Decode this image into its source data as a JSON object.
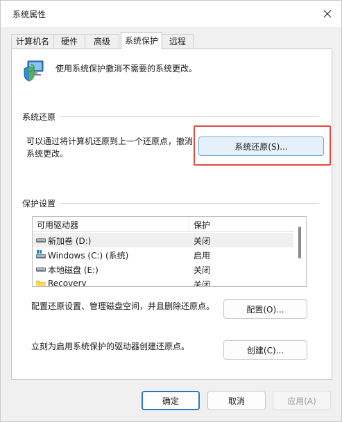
{
  "window": {
    "title": "系统属性"
  },
  "tabs": [
    {
      "label": "计算机名",
      "active": false
    },
    {
      "label": "硬件",
      "active": false
    },
    {
      "label": "高级",
      "active": false
    },
    {
      "label": "系统保护",
      "active": true
    },
    {
      "label": "远程",
      "active": false
    }
  ],
  "intro": {
    "text": "使用系统保护撤消不需要的系统更改。",
    "icon": "computer-shield-icon"
  },
  "restore": {
    "heading": "系统还原",
    "desc_line1": "可以通过将计算机还原到上一个还原点，撤消",
    "desc_line2": "系统更改。",
    "button": "系统还原(S)..."
  },
  "protection": {
    "heading": "保护设置",
    "col_drive": "可用驱动器",
    "col_protection": "保护",
    "drives": [
      {
        "name": "新加卷 (D:)",
        "protection": "关闭",
        "icon": "drive-icon",
        "selected": true
      },
      {
        "name": "Windows (C:) (系统)",
        "protection": "启用",
        "icon": "system-drive-icon",
        "selected": false
      },
      {
        "name": "本地磁盘 (E:)",
        "protection": "关闭",
        "icon": "drive-icon",
        "selected": false
      },
      {
        "name": "Recovery",
        "protection": "关闭",
        "icon": "folder-icon",
        "selected": false
      }
    ],
    "configure_text": "配置还原设置、管理磁盘空间，并且删除还原点。",
    "configure_button": "配置(O)...",
    "create_text": "立刻为启用系统保护的驱动器创建还原点。",
    "create_button": "创建(C)..."
  },
  "footer": {
    "ok": "确定",
    "cancel": "取消",
    "apply": "应用(A)"
  },
  "colors": {
    "highlight": "#e04a3f",
    "accent": "#2b78c4"
  }
}
